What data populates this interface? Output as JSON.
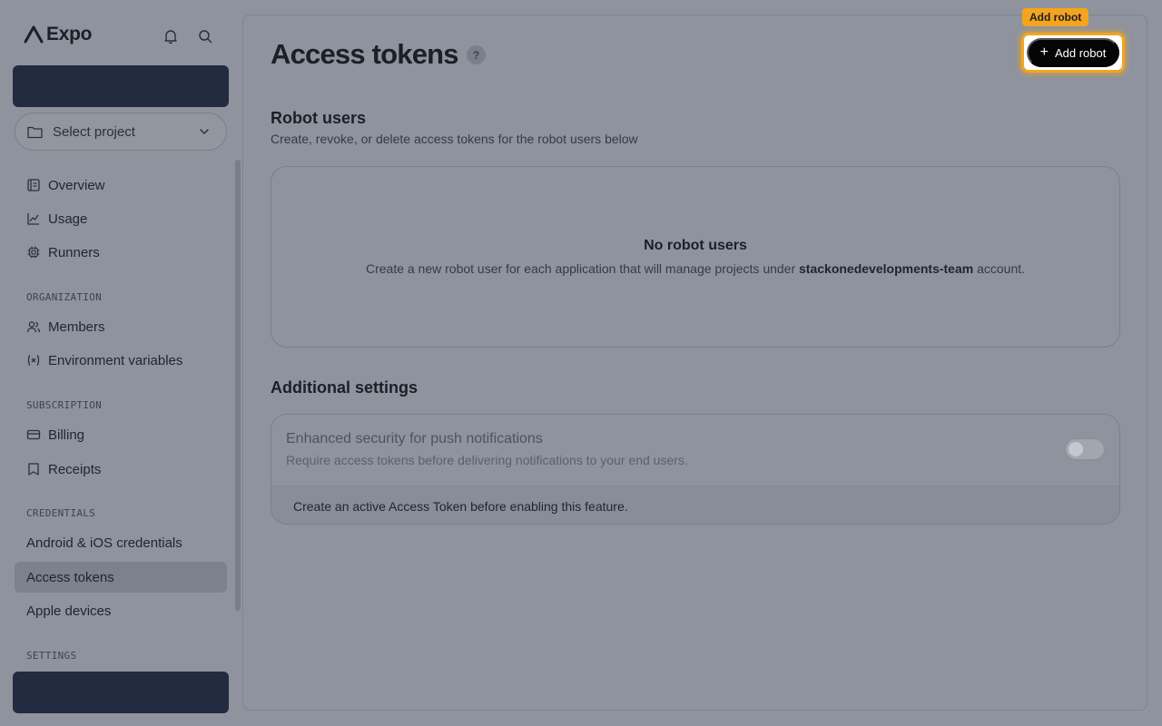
{
  "brand": {
    "name": "Expo"
  },
  "header": {
    "bell_icon": "bell-icon",
    "search_icon": "search-icon"
  },
  "project_select": {
    "label": "Select project",
    "icon": "folder-icon"
  },
  "nav": {
    "overview": "Overview",
    "usage": "Usage",
    "runners": "Runners",
    "org_label": "ORGANIZATION",
    "members": "Members",
    "env_vars": "Environment variables",
    "sub_label": "SUBSCRIPTION",
    "billing": "Billing",
    "receipts": "Receipts",
    "cred_label": "CREDENTIALS",
    "android_ios": "Android & iOS credentials",
    "access_tokens": "Access tokens",
    "apple_devices": "Apple devices",
    "settings_label": "SETTINGS"
  },
  "page": {
    "title": "Access tokens",
    "help": "?",
    "add_button": "Add robot",
    "tooltip": "Add robot"
  },
  "robots": {
    "title": "Robot users",
    "subtitle": "Create, revoke, or delete access tokens for the robot users below",
    "empty_title": "No robot users",
    "empty_prefix": "Create a new robot user for each application that will manage projects under ",
    "account": "stackonedevelopments-team",
    "empty_suffix": " account."
  },
  "additional": {
    "title": "Additional settings",
    "setting_title": "Enhanced security for push notifications",
    "setting_desc": "Require access tokens before delivering notifications to your end users.",
    "footer": "Create an active Access Token before enabling this feature."
  },
  "colors": {
    "accent": "#f4a41d",
    "dark_block": "#222b40",
    "button": "#050505"
  }
}
